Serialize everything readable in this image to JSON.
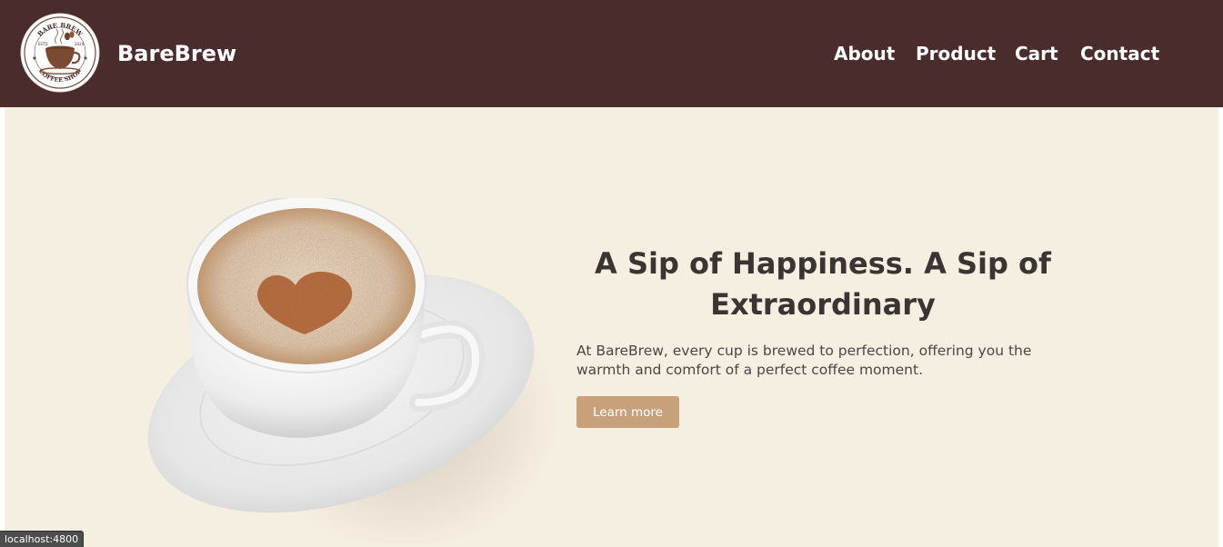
{
  "header": {
    "logo": {
      "icon": "coffee-cup-logo-icon",
      "top_text": "BARE BREW",
      "bottom_text": "COFFEE SHOP",
      "left_text": "ESTD",
      "right_text": "2024"
    },
    "brand": "BareBrew",
    "nav": {
      "about": "About",
      "product": "Product",
      "cart": "Cart",
      "contact": "Contact"
    }
  },
  "hero": {
    "image": "coffee-cup-heart-latte-art",
    "headline": "A Sip of Happiness. A Sip of Extraordinary",
    "description": "At BareBrew, every cup is brewed to perfection, offering you the warmth and comfort of a perfect coffee moment.",
    "cta_label": "Learn more"
  },
  "status_bar": {
    "url": "localhost:4800"
  },
  "colors": {
    "header_bg": "#4a2c2d",
    "hero_bg": "#f5efe2",
    "cta_bg": "#c8a07a",
    "headline": "#3a3433"
  }
}
